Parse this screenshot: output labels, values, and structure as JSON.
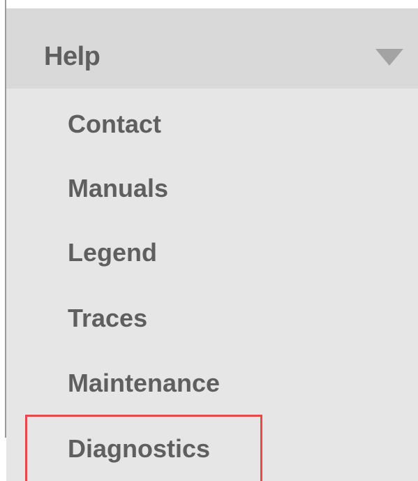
{
  "menu": {
    "header_label": "Help",
    "items": [
      {
        "label": "Contact"
      },
      {
        "label": "Manuals"
      },
      {
        "label": "Legend"
      },
      {
        "label": "Traces"
      },
      {
        "label": "Maintenance"
      },
      {
        "label": "Diagnostics"
      }
    ],
    "selected_item": "Diagnostics"
  },
  "colors": {
    "header_bg": "#d9d9d9",
    "body_bg": "#e6e6e6",
    "text": "#5f5f5f",
    "chevron": "#a3a3a3",
    "highlight": "#e8474e"
  },
  "icons": {
    "header_toggle": "chevron-down-icon"
  }
}
